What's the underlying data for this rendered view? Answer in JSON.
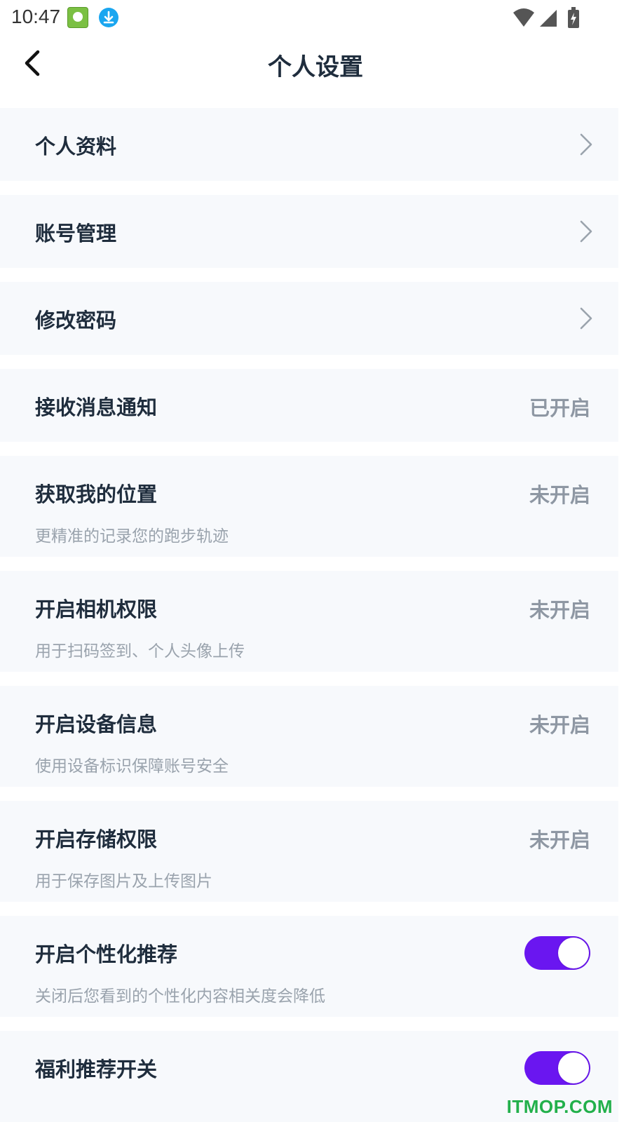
{
  "status_bar": {
    "time": "10:47"
  },
  "header": {
    "title": "个人设置"
  },
  "rows": [
    {
      "title": "个人资料"
    },
    {
      "title": "账号管理"
    },
    {
      "title": "修改密码"
    },
    {
      "title": "接收消息通知",
      "status": "已开启"
    },
    {
      "title": "获取我的位置",
      "status": "未开启",
      "subtitle": "更精准的记录您的跑步轨迹"
    },
    {
      "title": "开启相机权限",
      "status": "未开启",
      "subtitle": "用于扫码签到、个人头像上传"
    },
    {
      "title": "开启设备信息",
      "status": "未开启",
      "subtitle": "使用设备标识保障账号安全"
    },
    {
      "title": "开启存储权限",
      "status": "未开启",
      "subtitle": "用于保存图片及上传图片"
    },
    {
      "title": "开启个性化推荐",
      "subtitle": "关闭后您看到的个性化内容相关度会降低",
      "toggle_on": true
    },
    {
      "title": "福利推荐开关",
      "toggle_on": true
    }
  ],
  "colors": {
    "row_background": "#f7f9fc",
    "toggle_on": "#6a16f0",
    "title_text": "#1f2d3d",
    "status_text": "#8e97a3",
    "subtitle_text": "#9aa3ad",
    "watermark": "#22b04b"
  },
  "icons": {
    "back": "chevron-left-icon",
    "row_arrow": "chevron-right-icon",
    "wifi": "wifi-icon",
    "signal": "signal-icon",
    "battery": "battery-charging-icon",
    "download": "download-icon"
  },
  "watermark": "ITMOP.COM"
}
